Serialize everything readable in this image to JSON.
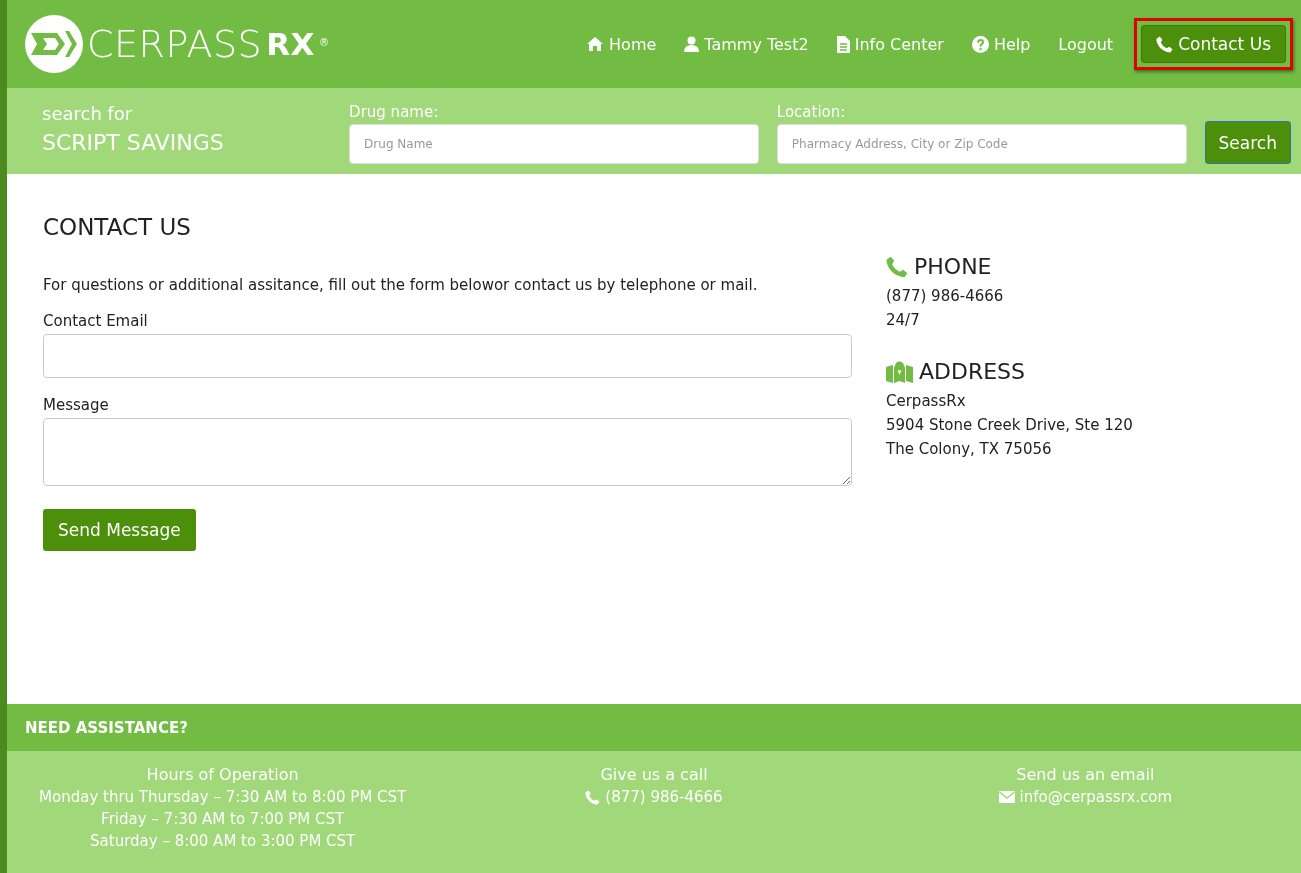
{
  "header": {
    "logo_text": "CERPASS",
    "logo_suffix": "RX",
    "logo_mark": "®",
    "nav": [
      {
        "label": "Home",
        "kind": "home",
        "highlighted": false
      },
      {
        "label": "Tammy Test2",
        "kind": "user",
        "highlighted": false
      },
      {
        "label": "Info Center",
        "kind": "document",
        "highlighted": false
      },
      {
        "label": "Help",
        "kind": "help",
        "highlighted": false
      },
      {
        "label": "Logout",
        "kind": "plain",
        "highlighted": false
      },
      {
        "label": "Contact Us",
        "kind": "phone-button",
        "highlighted": true
      }
    ]
  },
  "search_bar": {
    "tagline": "search for",
    "title": "SCRIPT SAVINGS",
    "fields": [
      {
        "label": "Drug name:",
        "placeholder": "Drug Name"
      },
      {
        "label": "Location:",
        "placeholder": "Pharmacy Address, City or Zip Code"
      }
    ],
    "button": "Search"
  },
  "contact": {
    "heading": "CONTACT US",
    "intro": "For questions or additional assitance, fill out the form belowor contact us by telephone or mail.",
    "fields": [
      {
        "label": "Contact Email",
        "kind": "input"
      },
      {
        "label": "Message",
        "kind": "textarea"
      }
    ],
    "button": "Send Message",
    "info": [
      {
        "kind": "phone",
        "title": "PHONE",
        "lines": [
          "(877) 986-4666",
          "24/7"
        ]
      },
      {
        "kind": "map",
        "title": "ADDRESS",
        "lines": [
          "CerpassRx",
          "5904 Stone Creek Drive, Ste 120",
          "The Colony, TX 75056"
        ]
      }
    ]
  },
  "footer": {
    "title": "NEED ASSISTANCE?",
    "columns": [
      {
        "heading": "Hours of Operation",
        "kind": "plain",
        "lines": [
          "Monday thru Thursday – 7:30 AM to 8:00 PM CST",
          "Friday – 7:30 AM to 7:00 PM CST",
          "Saturday – 8:00 AM to 3:00 PM CST"
        ]
      },
      {
        "heading": "Give us a call",
        "kind": "phone",
        "lines": [
          "(877) 986-4666"
        ]
      },
      {
        "heading": "Send us an email",
        "kind": "email",
        "lines": [
          "info@cerpassrx.com"
        ]
      }
    ]
  }
}
